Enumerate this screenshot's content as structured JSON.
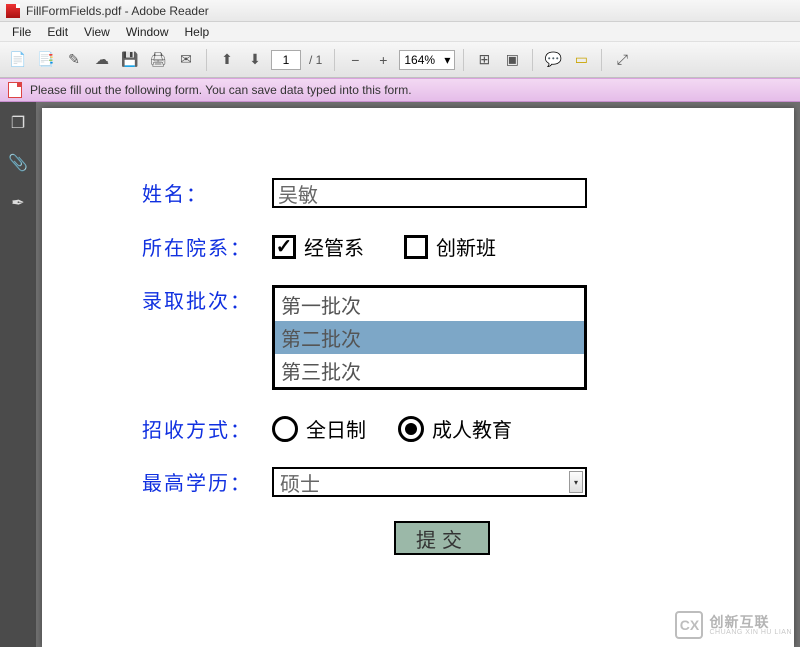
{
  "window": {
    "title": "FillFormFields.pdf - Adobe Reader"
  },
  "menu": {
    "file": "File",
    "edit": "Edit",
    "view": "View",
    "window": "Window",
    "help": "Help"
  },
  "toolbar": {
    "page_current": "1",
    "page_sep": "/ 1",
    "zoom": "164%"
  },
  "infobar": {
    "msg": "Please fill out the following form. You can save data typed into this form."
  },
  "form": {
    "name_label": "姓名：",
    "name_value": "吴敏",
    "dept_label": "所在院系：",
    "dept_opts": [
      {
        "label": "经管系",
        "checked": true
      },
      {
        "label": "创新班",
        "checked": false
      }
    ],
    "batch_label": "录取批次：",
    "batch_opts": [
      "第一批次",
      "第二批次",
      "第三批次"
    ],
    "batch_selected": 1,
    "mode_label": "招收方式：",
    "mode_opts": [
      {
        "label": "全日制",
        "checked": false
      },
      {
        "label": "成人教育",
        "checked": true
      }
    ],
    "edu_label": "最高学历：",
    "edu_value": "硕士",
    "submit": "提交"
  },
  "watermark": {
    "brand": "创新互联",
    "sub": "CHUANG XIN HU LIAN",
    "logo": "CX"
  }
}
